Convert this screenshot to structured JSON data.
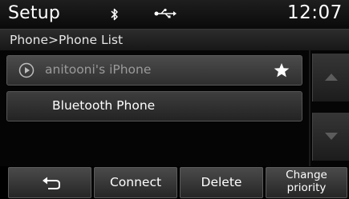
{
  "header": {
    "title": "Setup",
    "time": "12:07",
    "icons": [
      "bluetooth-icon",
      "usb-icon"
    ]
  },
  "breadcrumb": {
    "text": "Phone>Phone List"
  },
  "phone_list": {
    "items": [
      {
        "name": "anitooni's iPhone",
        "icon": "play-circle-icon",
        "priority": true
      },
      {
        "name": "Bluetooth Phone"
      }
    ]
  },
  "scroll": {
    "up_icon": "arrow-up-icon",
    "down_icon": "arrow-down-icon"
  },
  "buttons": {
    "back_icon": "return-arrow-icon",
    "connect": "Connect",
    "delete": "Delete",
    "change_priority_line1": "Change",
    "change_priority_line2": "priority"
  },
  "colors": {
    "background": "#000000",
    "text": "#ffffff",
    "inactive_text": "#9a9a9a"
  }
}
